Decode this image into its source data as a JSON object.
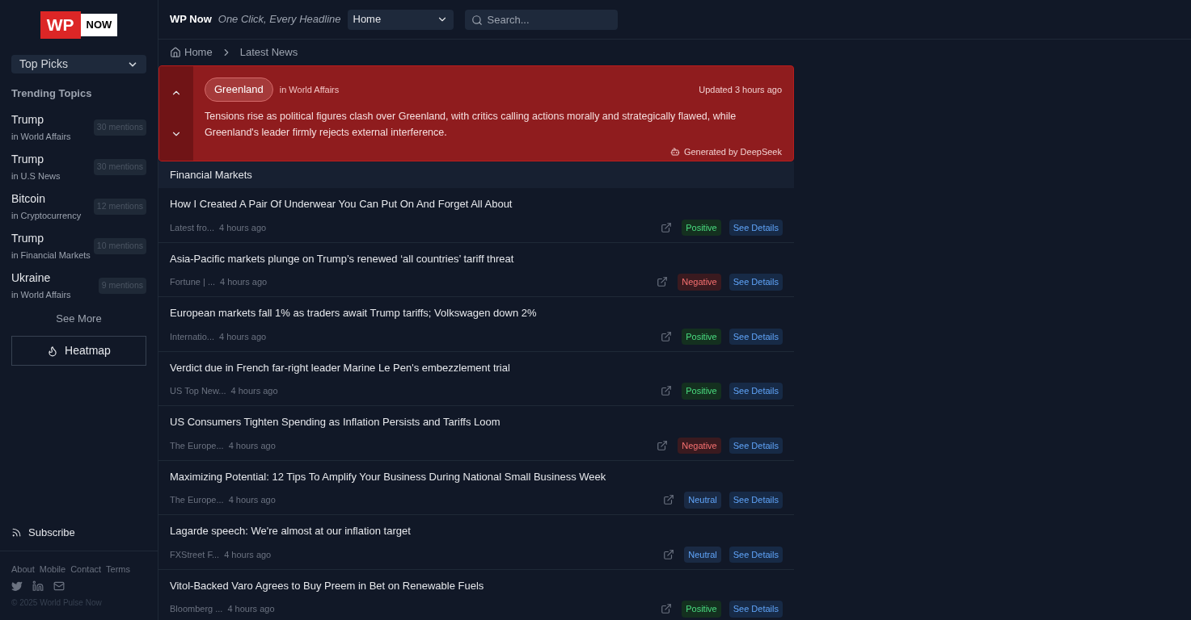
{
  "logo": {
    "mark": "WP",
    "word": "NOW"
  },
  "sidebar": {
    "picker": "Top Picks",
    "trending_title": "Trending Topics",
    "topics": [
      {
        "name": "Trump",
        "category": "in World Affairs",
        "mentions": "30 mentions"
      },
      {
        "name": "Trump",
        "category": "in U.S News",
        "mentions": "30 mentions"
      },
      {
        "name": "Bitcoin",
        "category": "in Cryptocurrency",
        "mentions": "12 mentions"
      },
      {
        "name": "Trump",
        "category": "in Financial Markets",
        "mentions": "10 mentions"
      },
      {
        "name": "Ukraine",
        "category": "in World Affairs",
        "mentions": "9 mentions"
      }
    ],
    "see_more": "See More",
    "heatmap": "Heatmap",
    "subscribe": "Subscribe",
    "footer_links": [
      "About",
      "Mobile",
      "Contact",
      "Terms"
    ],
    "copyright": "© 2025 World Pulse Now"
  },
  "header": {
    "brand": "WP Now",
    "tagline": "One Click, Every Headline",
    "section_select": "Home",
    "search": {
      "placeholder": "Search..."
    }
  },
  "breadcrumb": [
    "Home",
    "Latest News"
  ],
  "summary": {
    "topic": "Greenland",
    "category": "in World Affairs",
    "updated": "Updated 3 hours ago",
    "text": "Tensions rise as political figures clash over Greenland, with critics calling actions morally and strategically flawed, while Greenland's leader firmly rejects external interference.",
    "generated": "Generated by DeepSeek"
  },
  "section_title": "Financial Markets",
  "articles": [
    {
      "title": "How I Created A Pair Of Underwear You Can Put On And Forget All About",
      "source": "Latest fro...",
      "time": "4 hours ago",
      "sentiment": "Positive",
      "kind": "positive",
      "details": "See Details"
    },
    {
      "title": "Asia-Pacific markets plunge on Trump’s renewed ‘all countries’ tariff threat",
      "source": "Fortune | ...",
      "time": "4 hours ago",
      "sentiment": "Negative",
      "kind": "negative",
      "details": "See Details"
    },
    {
      "title": "European markets fall 1% as traders await Trump tariffs; Volkswagen down 2%",
      "source": "Internatio...",
      "time": "4 hours ago",
      "sentiment": "Positive",
      "kind": "positive",
      "details": "See Details"
    },
    {
      "title": "Verdict due in French far-right leader Marine Le Pen's embezzlement trial",
      "source": "US Top New...",
      "time": "4 hours ago",
      "sentiment": "Positive",
      "kind": "positive",
      "details": "See Details"
    },
    {
      "title": "US Consumers Tighten Spending as Inflation Persists and Tariffs Loom",
      "source": "The Europe...",
      "time": "4 hours ago",
      "sentiment": "Negative",
      "kind": "negative",
      "details": "See Details"
    },
    {
      "title": "Maximizing Potential: 12 Tips To Amplify Your Business During National Small Business Week",
      "source": "The Europe...",
      "time": "4 hours ago",
      "sentiment": "Neutral",
      "kind": "neutral",
      "details": "See Details"
    },
    {
      "title": "Lagarde speech: We're almost at our inflation target",
      "source": "FXStreet F...",
      "time": "4 hours ago",
      "sentiment": "Neutral",
      "kind": "neutral",
      "details": "See Details"
    },
    {
      "title": "Vitol-Backed Varo Agrees to Buy Preem in Bet on Renewable Fuels",
      "source": "Bloomberg ...",
      "time": "4 hours ago",
      "sentiment": "Positive",
      "kind": "positive",
      "details": "See Details"
    }
  ]
}
